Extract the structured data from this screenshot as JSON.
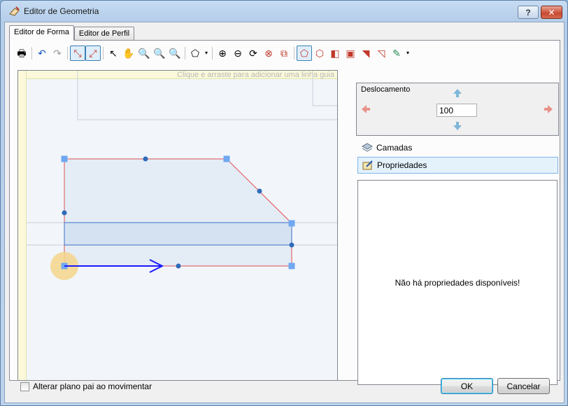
{
  "window": {
    "title": "Editor de Geometria",
    "help_label": "?",
    "close_label": "✕"
  },
  "tabs": [
    {
      "label": "Editor de Forma",
      "active": true
    },
    {
      "label": "Editor de Perfil",
      "active": false
    }
  ],
  "toolbar": {
    "tools": [
      {
        "name": "print-icon",
        "glyph": "🖶"
      },
      {
        "name": "sep"
      },
      {
        "name": "undo-icon",
        "glyph": "↶",
        "color": "#1a56c8"
      },
      {
        "name": "redo-icon",
        "glyph": "↷",
        "color": "#9a9a9a"
      },
      {
        "name": "sep"
      },
      {
        "name": "select-edit-icon",
        "glyph": "⤡",
        "checked": true,
        "color": "#c0392b"
      },
      {
        "name": "snap-icon",
        "glyph": "⤢",
        "checked": true,
        "color": "#c0392b"
      },
      {
        "name": "sep"
      },
      {
        "name": "pointer-icon",
        "glyph": "↖"
      },
      {
        "name": "pan-hand-icon",
        "glyph": "✋",
        "color": "#b8860b"
      },
      {
        "name": "zoom-icon",
        "glyph": "🔍"
      },
      {
        "name": "zoom-out-icon",
        "glyph": "🔍"
      },
      {
        "name": "zoom-fit-icon",
        "glyph": "🔍"
      },
      {
        "name": "sep"
      },
      {
        "name": "shape-dropdown-icon",
        "glyph": "⬠"
      },
      {
        "name": "dropdown-arrow-icon",
        "glyph": "▾",
        "small": true
      },
      {
        "name": "sep"
      },
      {
        "name": "add-point-icon",
        "glyph": "⊕"
      },
      {
        "name": "remove-point-icon",
        "glyph": "⊖"
      },
      {
        "name": "rotate-icon",
        "glyph": "⟳"
      },
      {
        "name": "delete-shape-icon",
        "glyph": "⊗",
        "color": "#c0392b"
      },
      {
        "name": "copy-icon",
        "glyph": "⧉",
        "color": "#c0392b"
      },
      {
        "name": "sep"
      },
      {
        "name": "polygon-icon",
        "glyph": "⬠",
        "checked": true,
        "color": "#c0392b"
      },
      {
        "name": "curve-icon",
        "glyph": "⬡",
        "color": "#c0392b"
      },
      {
        "name": "flip-icon",
        "glyph": "◧",
        "color": "#c0392b"
      },
      {
        "name": "rectangle-icon",
        "glyph": "▣",
        "color": "#c0392b"
      },
      {
        "name": "chamfer-icon",
        "glyph": "◥",
        "color": "#c0392b"
      },
      {
        "name": "fillet-icon",
        "glyph": "◹",
        "color": "#c0392b"
      },
      {
        "name": "dxf-import-icon",
        "glyph": "✎",
        "color": "#2e8b57"
      },
      {
        "name": "dropdown-arrow-icon",
        "glyph": "▾",
        "small": true
      }
    ]
  },
  "canvas": {
    "guide_hint": "Clique e arraste para adicionar uma linha guia"
  },
  "shift": {
    "title": "Deslocamento",
    "value": "100"
  },
  "panels": {
    "layers_label": "Camadas",
    "properties_label": "Propriedades"
  },
  "properties": {
    "empty_message": "Não há propriedades disponíveis!"
  },
  "footer": {
    "checkbox_label": "Alterar plano pai ao movimentar",
    "ok_label": "OK",
    "cancel_label": "Cancelar"
  },
  "colors": {
    "shape_fill": "#e4ecf6",
    "shape_stroke": "#e05050",
    "node": "#2e6bb8",
    "handle": "#6fa8f0",
    "vector_arrow": "#1a1aff",
    "origin_marker": "#f5d58a",
    "arrow_active": "#7fb6d9",
    "arrow_inactive": "#e8938a"
  }
}
